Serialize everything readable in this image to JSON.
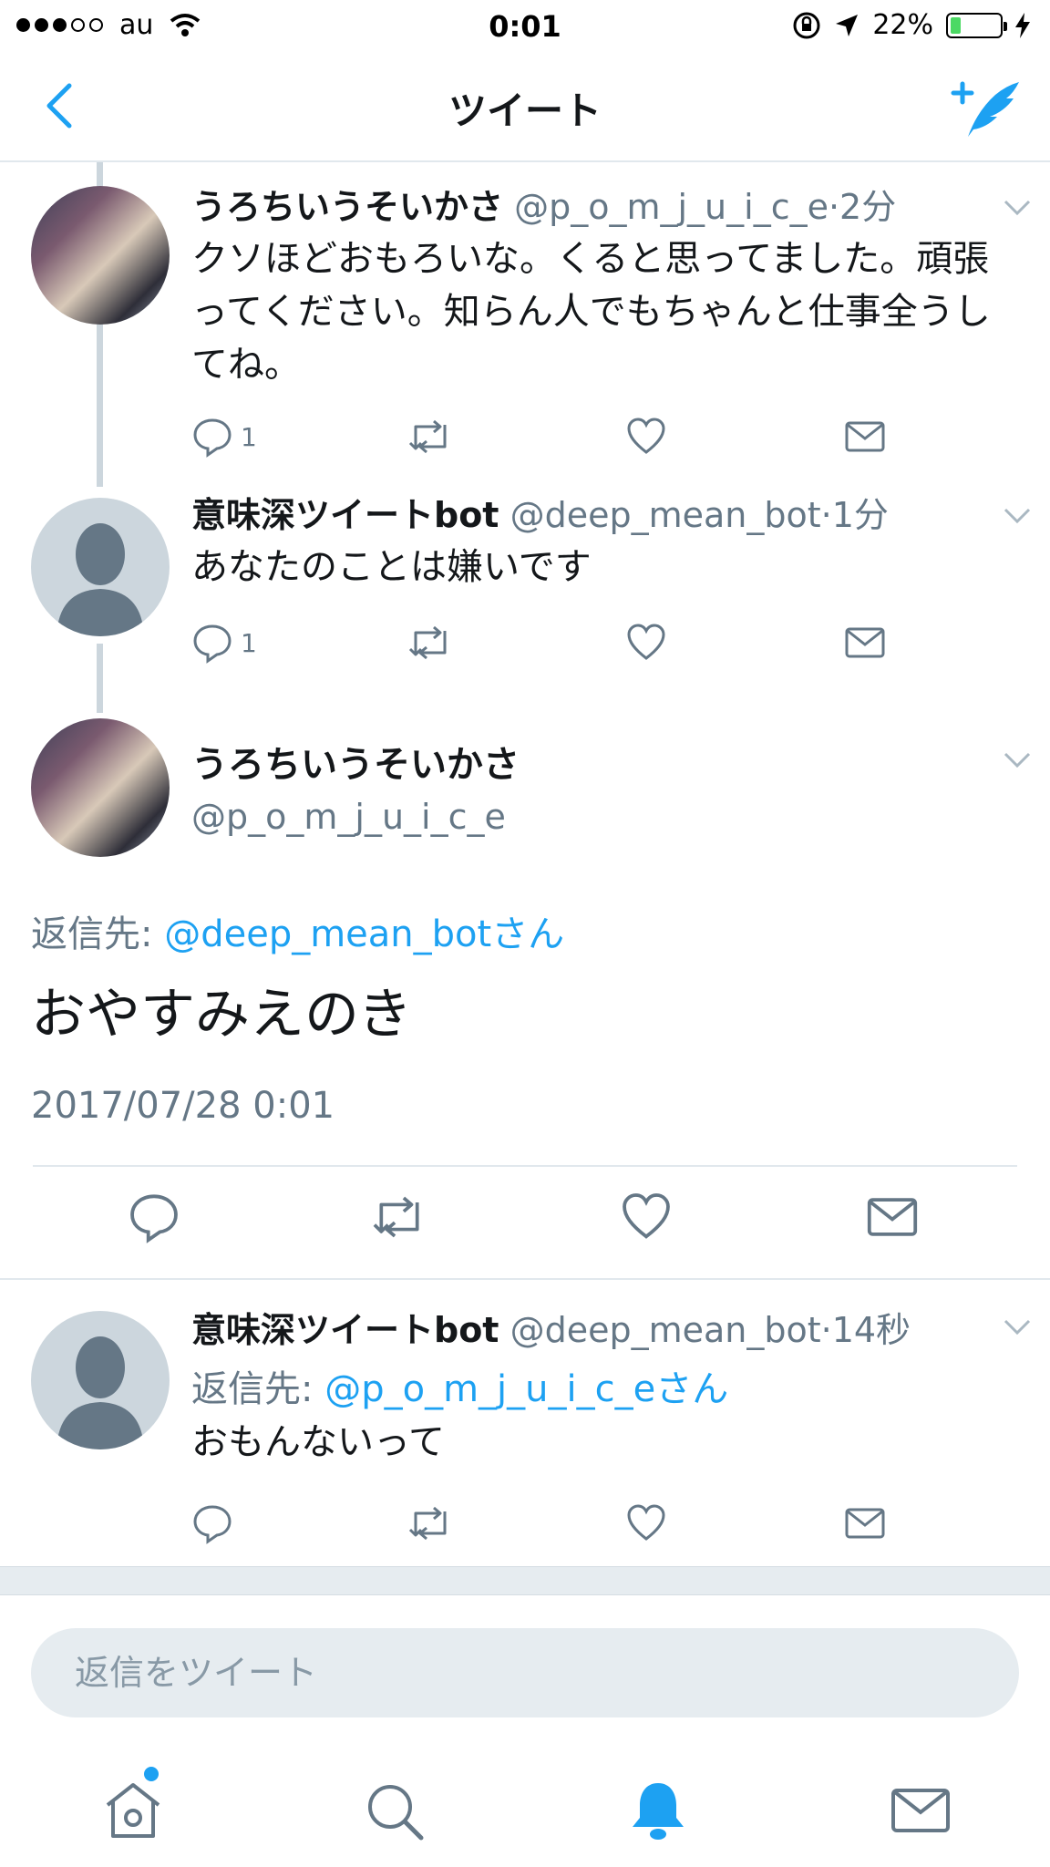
{
  "status_bar": {
    "carrier": "au",
    "time": "0:01",
    "battery_percent": "22%",
    "battery_level": 0.22,
    "signal_bars": 3
  },
  "nav": {
    "title": "ツイート"
  },
  "colors": {
    "accent": "#1da1f2",
    "secondary_text": "#657786",
    "divider": "#e1e8ed",
    "avatar_default": "#ccd6dd"
  },
  "thread": [
    {
      "name": "うろちいうそいかさ",
      "handle": "@p_o_m_j_u_i_c_e",
      "time": "·2分",
      "text": "クソほどおもろいな。くると思ってました。頑張ってください。知らん人でもちゃんと仕事全うしてね。",
      "reply_count": "1"
    },
    {
      "name": "意味深ツイートbot",
      "handle": "@deep_mean_bot",
      "time": "·1分",
      "text": "あなたのことは嫌いです",
      "reply_count": "1"
    }
  ],
  "focus_tweet": {
    "name": "うろちいうそいかさ",
    "handle": "@p_o_m_j_u_i_c_e",
    "reply_to_prefix": "返信先: ",
    "reply_to": "@deep_mean_botさん",
    "text": "おやすみえのき",
    "timestamp": "2017/07/28 0:01"
  },
  "reply_tweet": {
    "name": "意味深ツイートbot",
    "handle": "@deep_mean_bot",
    "time": "·14秒",
    "reply_to_prefix": "返信先: ",
    "reply_to": "@p_o_m_j_u_i_c_eさん",
    "text": "おもんないって"
  },
  "reply_box": {
    "placeholder": "返信をツイート"
  },
  "tabs": [
    "home-icon",
    "search-icon",
    "notifications-icon",
    "messages-icon"
  ]
}
